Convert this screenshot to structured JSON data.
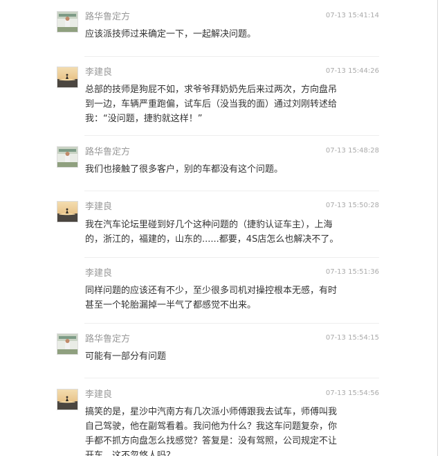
{
  "posts": [
    {
      "author": "路华鲁定方",
      "time": "07-13 15:41:14",
      "avatar": "dealer-logo-icon",
      "text": "应该派技师过来确定一下，一起解决问题。"
    },
    {
      "author": "李建良",
      "time": "07-13 15:44:26",
      "avatar": "sunset-lake-icon",
      "text": "总部的技师是狗屁不如，求爷爷拜奶奶先后来过两次，方向盘吊\n到一边，车辆严重跑偏，试车后（没当我的面）通过刘刚转述给\n我：“没问题，捷豹就这样！”"
    },
    {
      "author": "路华鲁定方",
      "time": "07-13 15:48:28",
      "avatar": "dealer-logo-icon",
      "text": "我们也接触了很多客户，别的车都没有这个问题。"
    },
    {
      "author": "李建良",
      "time": "07-13 15:50:28",
      "avatar": "sunset-lake-icon",
      "text": "我在汽车论坛里碰到好几个这种问题的（捷豹认证车主），上海\n的，浙江的，福建的，山东的......都要，4S店怎么也解决不了。"
    },
    {
      "author": "李建良",
      "time": "07-13 15:51:36",
      "avatar": "",
      "text": "同样问题的应该还有不少，至少很多司机对操控根本无感，有时\n甚至一个轮胎漏掉一半气了都感觉不出来。"
    },
    {
      "author": "路华鲁定方",
      "time": "07-13 15:54:15",
      "avatar": "dealer-logo-icon",
      "text": "可能有一部分有问题"
    },
    {
      "author": "李建良",
      "time": "07-13 15:54:56",
      "avatar": "sunset-lake-icon",
      "text": "搞笑的是，星沙中汽南方有几次派小师傅跟我去试车，师傅叫我\n自己驾驶，他在副驾看着。我问他为什么？我这车问题复杂，你\n手都不抓方向盘怎么找感觉？答复是：没有驾照，公司规定不让\n开车，这不忽悠人吗？"
    }
  ]
}
